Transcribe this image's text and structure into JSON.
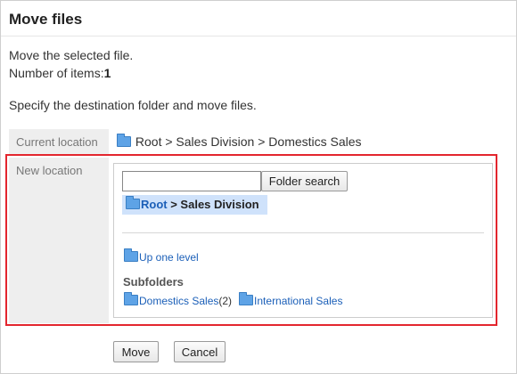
{
  "page": {
    "title": "Move files",
    "description": "Move the selected file.",
    "items_label": "Number of items:",
    "items_count": "1",
    "instruction": "Specify the destination folder and move files."
  },
  "current_location": {
    "label": "Current location",
    "path": "Root > Sales Division > Domestics Sales"
  },
  "new_location": {
    "label": "New location",
    "search": {
      "value": "",
      "button_label": "Folder search"
    },
    "selected_root": "Root",
    "selected_rest": " > Sales Division",
    "up_one_level": "Up one level",
    "subfolders_title": "Subfolders",
    "subfolders": [
      {
        "name": "Domestics Sales",
        "count": "(2)"
      },
      {
        "name": "International Sales",
        "count": ""
      }
    ]
  },
  "actions": {
    "move_label": "Move",
    "cancel_label": "Cancel"
  },
  "colors": {
    "highlight_border": "#e3262e",
    "link": "#1b5fb8",
    "selected_bg": "#cfe2fb",
    "folder_icon": "#5ea3e6"
  },
  "icons": [
    "folder-icon"
  ]
}
